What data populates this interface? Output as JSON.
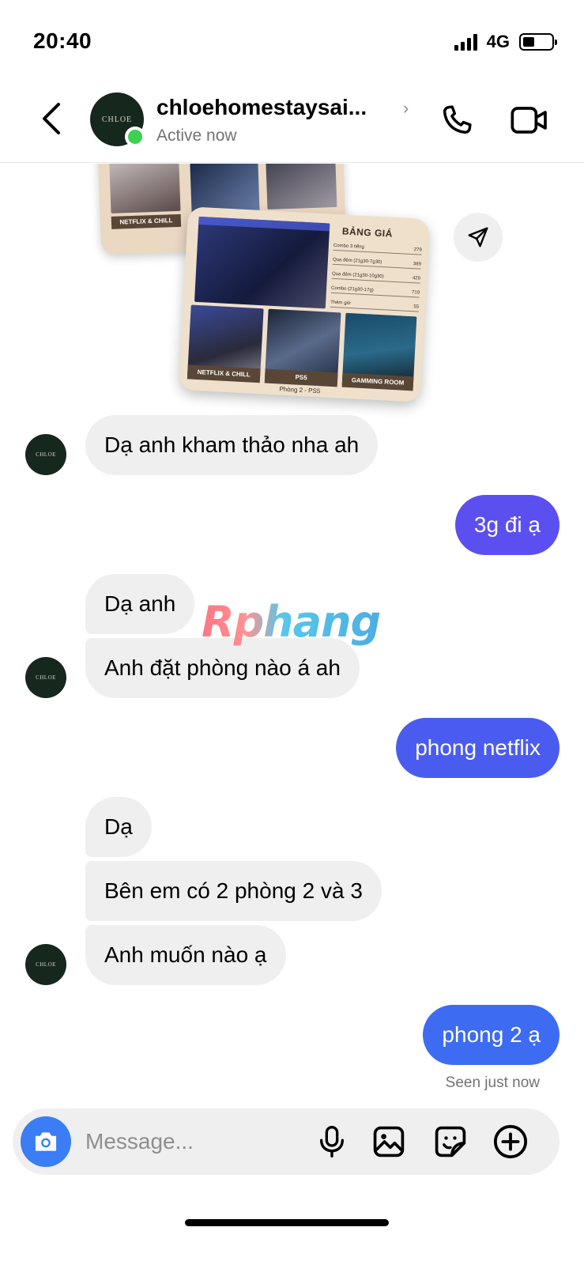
{
  "status_bar": {
    "time": "20:40",
    "network": "4G",
    "battery_level": 0.4,
    "signal_bars": 4
  },
  "header": {
    "avatar_text": "CHLOE",
    "name": "chloehomestaysai...",
    "chevron": "›",
    "status": "Active now",
    "icons": {
      "back": "chevron-left-icon",
      "call": "phone-icon",
      "video": "video-camera-icon",
      "share": "send-icon"
    }
  },
  "promo_image": {
    "back_caption": "NETFLIX & CHILL",
    "price_title": "BẢNG GIÁ",
    "price_rows": [
      {
        "label": "Combo 3 tiếng",
        "price": "279"
      },
      {
        "label": "Qua đêm (21g30-7g30)",
        "price": "389"
      },
      {
        "label": "Qua đêm (21g30-10g30)",
        "price": "429"
      },
      {
        "label": "Combo (21g30-17g)",
        "price": "719"
      },
      {
        "label": "Thêm giờ",
        "price": "55"
      }
    ],
    "captions": [
      "NETFLIX & CHILL",
      "PS5",
      "GAMMING ROOM"
    ],
    "bottom_text": "Phòng 2 - PS5"
  },
  "watermark": "Rphang",
  "messages": [
    {
      "from": "them",
      "text": "Dạ anh kham thảo nha ah"
    },
    {
      "from": "me",
      "text": "3g đi ạ"
    },
    {
      "from": "them",
      "text": "Dạ anh"
    },
    {
      "from": "them",
      "text": "Anh đặt phòng nào á ah"
    },
    {
      "from": "me",
      "text": "phong netflix"
    },
    {
      "from": "them",
      "text": "Dạ"
    },
    {
      "from": "them",
      "text": "Bên em có 2 phòng 2 và 3"
    },
    {
      "from": "them",
      "text": "Anh muốn nào ạ"
    },
    {
      "from": "me",
      "text": "phong 2 ạ"
    }
  ],
  "seen_text": "Seen just now",
  "composer": {
    "placeholder": "Message...",
    "icons": [
      "camera-icon",
      "microphone-icon",
      "gallery-icon",
      "sticker-icon",
      "plus-circle-icon"
    ]
  },
  "colors": {
    "outgoing_bubble": "#5b4ff0",
    "incoming_bubble": "#efefef",
    "camera_button": "#3a7df5",
    "online_dot": "#3dd154"
  }
}
